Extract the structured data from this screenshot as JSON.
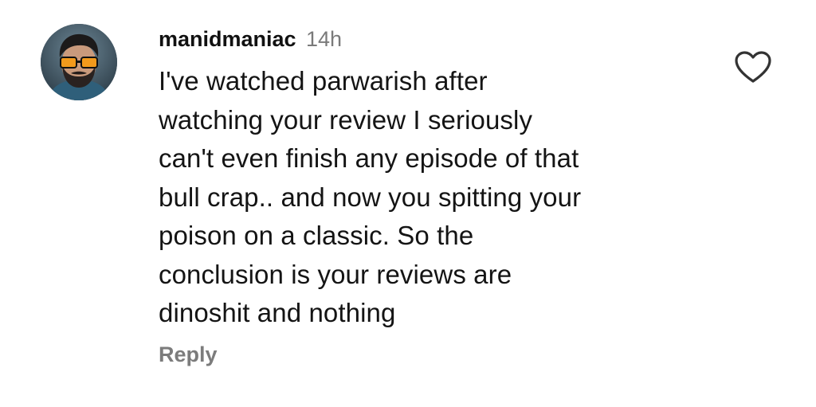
{
  "comment": {
    "username": "manidmaniac",
    "timestamp": "14h",
    "text": "I've watched parwarish after\nwatching your review I seriously\ncan't even finish any episode of that\nbull crap.. and now you spitting your\npoison on a classic. So the\nconclusion is your reviews are\ndinoshit and nothing",
    "reply_label": "Reply",
    "avatar_icon": "user-avatar",
    "like_icon": "heart-outline-icon"
  },
  "colors": {
    "text": "#141414",
    "muted": "#7a7a7a",
    "background": "#ffffff"
  }
}
